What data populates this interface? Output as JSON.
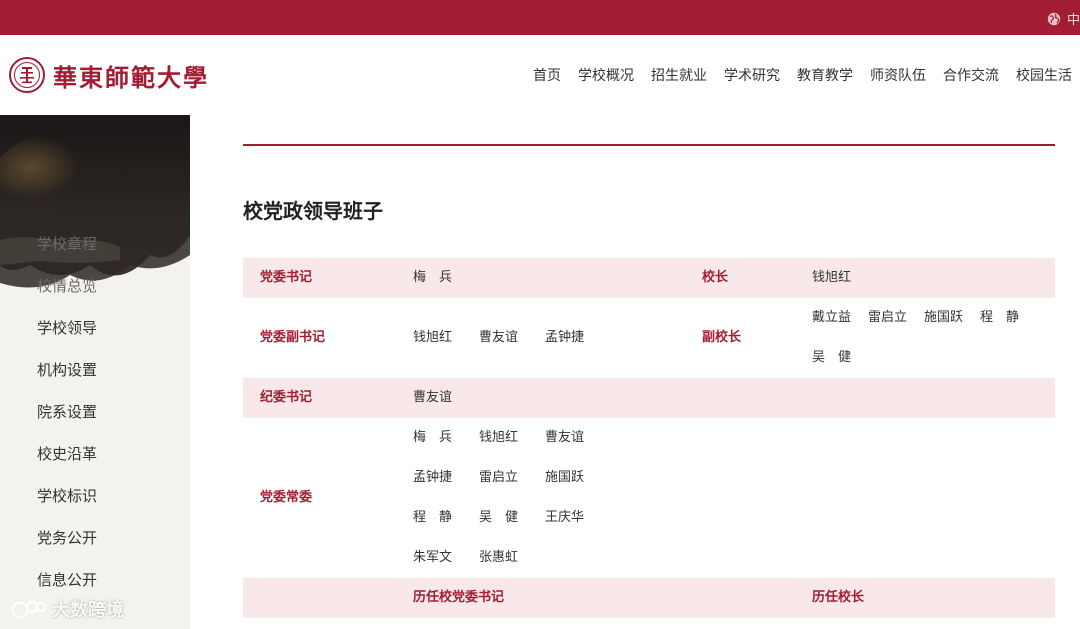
{
  "topbar": {
    "lang_label": "中"
  },
  "header": {
    "logo_text": "華東師範大學",
    "nav": [
      "首页",
      "学校概况",
      "招生就业",
      "学术研究",
      "教育教学",
      "师资队伍",
      "合作交流",
      "校园生活"
    ]
  },
  "sidebar": {
    "items": [
      "学校章程",
      "校情总览",
      "学校领导",
      "机构设置",
      "院系设置",
      "校史沿革",
      "学校标识",
      "党务公开",
      "信息公开"
    ]
  },
  "watermark": {
    "text": "大数跨境"
  },
  "page": {
    "title": "校党政领导班子"
  },
  "leaders": {
    "party_secretary": {
      "label": "党委书记",
      "names": [
        "梅　兵"
      ]
    },
    "president": {
      "label": "校长",
      "names": [
        "钱旭红"
      ]
    },
    "deputy_party_secretary": {
      "label": "党委副书记",
      "names": [
        "钱旭红",
        "曹友谊",
        "孟钟捷"
      ]
    },
    "vice_president": {
      "label": "副校长",
      "lines": [
        [
          "戴立益",
          "雷启立",
          "施国跃",
          "程　静"
        ],
        [
          "吴　健"
        ]
      ]
    },
    "discipline_secretary": {
      "label": "纪委书记",
      "names": [
        "曹友谊"
      ]
    },
    "standing_committee": {
      "label": "党委常委",
      "lines": [
        [
          "梅　兵",
          "钱旭红",
          "曹友谊"
        ],
        [
          "孟钟捷",
          "雷启立",
          "施国跃"
        ],
        [
          "程　静",
          "吴　健",
          "王庆华"
        ],
        [
          "朱军文",
          "张惠虹"
        ]
      ]
    },
    "history": {
      "party_secretaries_label": "历任校党委书记",
      "presidents_label": "历任校长"
    }
  },
  "colors": {
    "brand": "#a21d33",
    "row_pink": "#f8e8ea",
    "sidebar_bg": "#f3f2ef"
  }
}
